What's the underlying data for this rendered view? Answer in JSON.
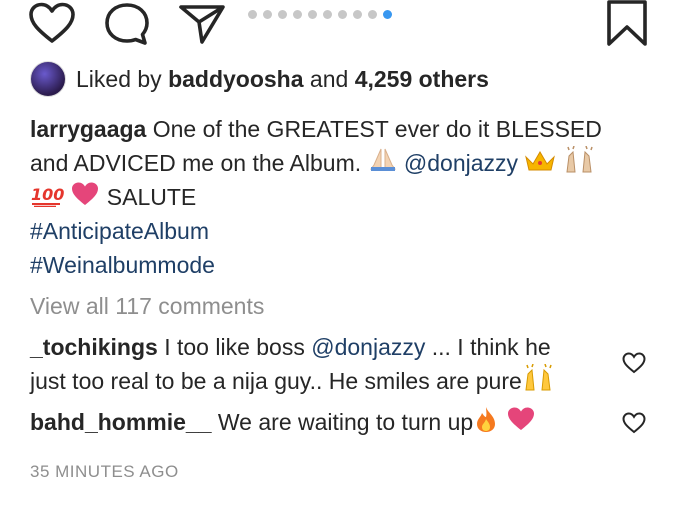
{
  "actions": {
    "like_icon": "heart-outline-icon",
    "comment_icon": "comment-bubble-icon",
    "share_icon": "paper-plane-icon",
    "save_icon": "bookmark-icon",
    "carousel": {
      "total": 10,
      "active_index": 9,
      "active_color": "#3897f0"
    }
  },
  "likes": {
    "prefix": "Liked by",
    "user": "baddyoosha",
    "connector": "and",
    "others": "4,259 others"
  },
  "caption": {
    "username": "larrygaaga",
    "text_part1": "One of the GREATEST ever do it BLESSED",
    "text_part2": "and ADVICED me on the Album.",
    "mention": "@donjazzy",
    "text_part3": "SALUTE",
    "hashtags": [
      "#AnticipateAlbum",
      "#Weinalbummode"
    ]
  },
  "view_all": "View all 117 comments",
  "comments": [
    {
      "username": "_tochikings",
      "text_a": "I too like boss",
      "mention": "@donjazzy",
      "text_b": "... I think he",
      "text_c": "just too real to be a nija guy.. He smiles are pure"
    },
    {
      "username": "bahd_hommie__",
      "text_a": "We are waiting to turn up"
    }
  ],
  "timestamp": "35 MINUTES AGO"
}
